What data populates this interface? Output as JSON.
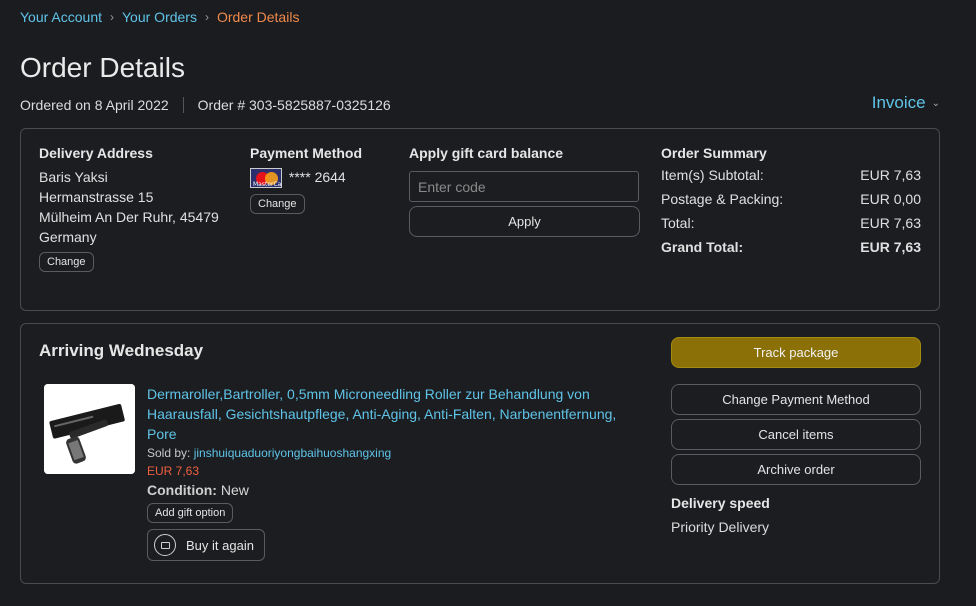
{
  "breadcrumb": {
    "items": [
      "Your Account",
      "Your Orders"
    ],
    "current": "Order Details"
  },
  "page_title": "Order Details",
  "order_meta": {
    "ordered_on": "Ordered on 8 April 2022",
    "order_number": "Order # 303-5825887-0325126"
  },
  "invoice_label": "Invoice",
  "delivery": {
    "title": "Delivery Address",
    "name": "Baris Yaksi",
    "street": "Hermanstrasse 15",
    "city": "Mülheim An Der Ruhr, 45479",
    "country": "Germany",
    "change_label": "Change"
  },
  "payment": {
    "title": "Payment Method",
    "card_brand_text": "MasterCard",
    "card_masked": "**** 2644",
    "change_label": "Change"
  },
  "gift": {
    "title": "Apply gift card balance",
    "placeholder": "Enter code",
    "apply_label": "Apply"
  },
  "summary": {
    "title": "Order Summary",
    "rows": [
      {
        "label": "Item(s) Subtotal:",
        "value": "EUR 7,63"
      },
      {
        "label": "Postage & Packing:",
        "value": "EUR 0,00"
      },
      {
        "label": "Total:",
        "value": "EUR 7,63"
      }
    ],
    "grand_total_label": "Grand Total:",
    "grand_total_value": "EUR 7,63"
  },
  "shipment": {
    "arriving": "Arriving Wednesday",
    "product_title": "Dermaroller,Bartroller, 0,5mm Microneedling Roller zur Behandlung von Haarausfall, Gesichtshautpflege, Anti-Aging, Anti-Falten, Narbenentfernung, Pore",
    "sold_by_label": "Sold by:",
    "seller": "jinshuiquaduoriyongbaihuoshangxing",
    "price": "EUR 7,63",
    "condition_label": "Condition:",
    "condition_value": "New",
    "gift_option_label": "Add gift option",
    "buy_again_label": "Buy it again"
  },
  "actions": {
    "track_label": "Track package",
    "change_payment_label": "Change Payment Method",
    "cancel_label": "Cancel items",
    "archive_label": "Archive order",
    "delivery_speed_title": "Delivery speed",
    "delivery_speed_value": "Priority Delivery"
  },
  "colors": {
    "background": "#1b1c20",
    "link": "#5fc4e8",
    "breadcrumb_current": "#f08a4b",
    "price": "#f06040",
    "primary_button": "#8a7006"
  }
}
